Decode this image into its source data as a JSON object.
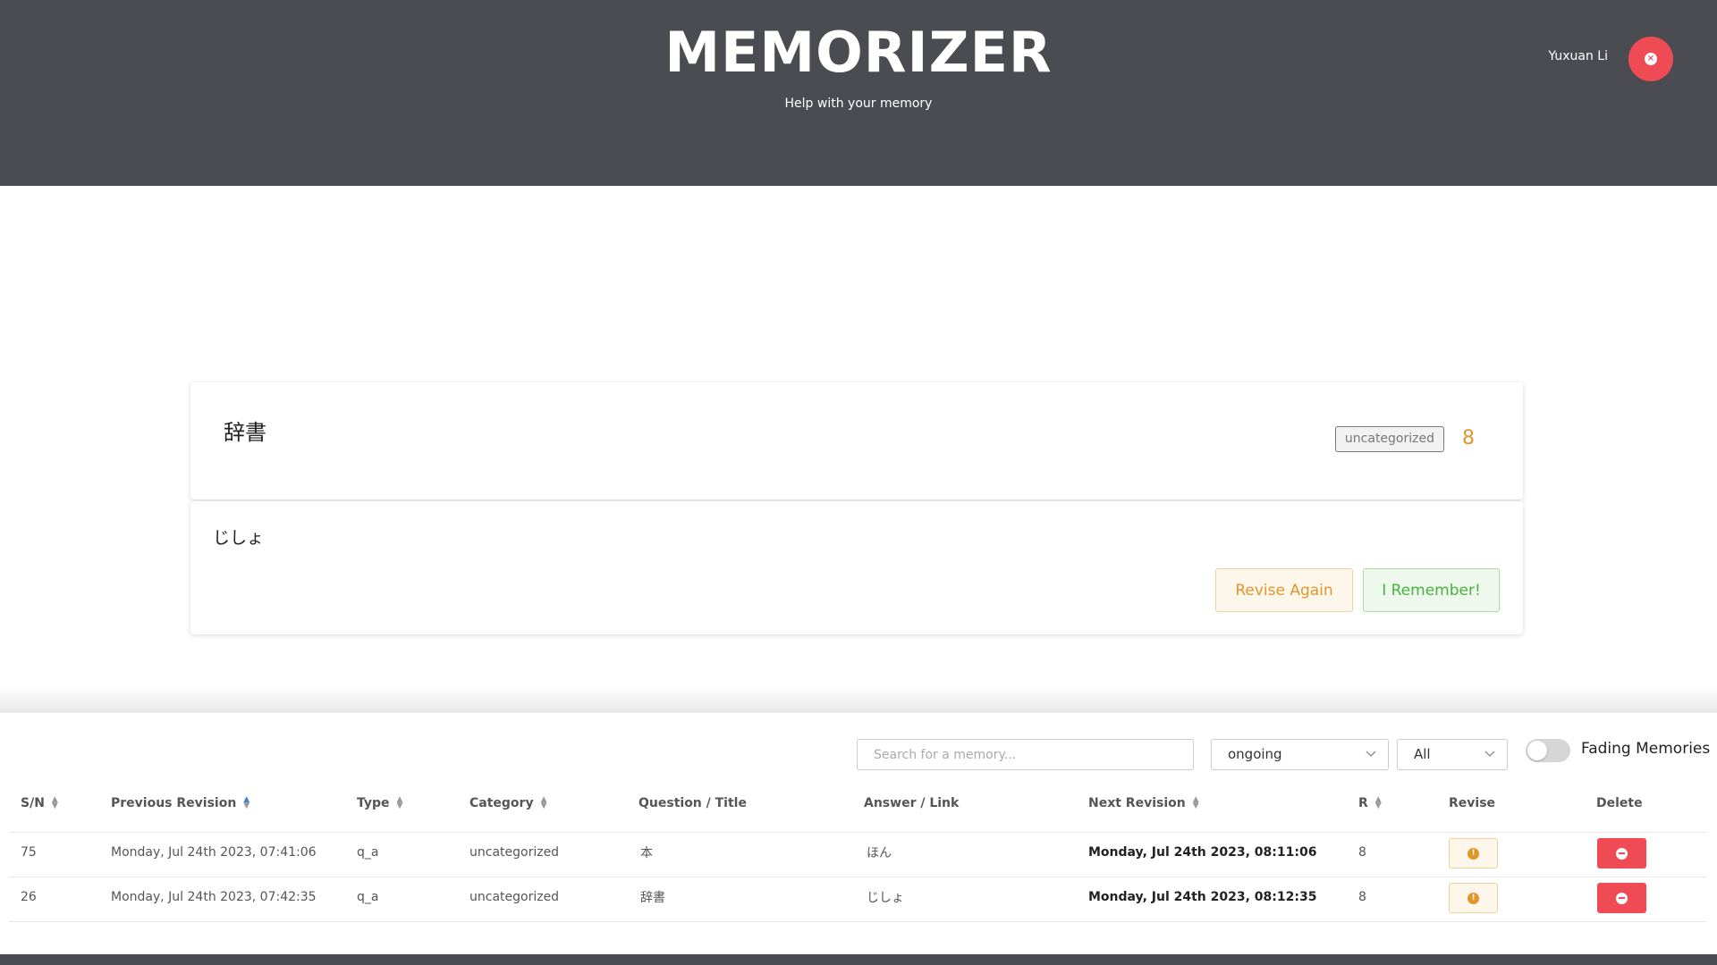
{
  "header": {
    "title": "MEMORIZER",
    "subtitle": "Help with your memory",
    "user_name": "Yuxuan Li",
    "logout_icon": "close-circle-icon"
  },
  "card": {
    "question": "辞書",
    "category": "uncategorized",
    "repetitions": "8",
    "answer": "じしょ",
    "revise_again_label": "Revise Again",
    "remember_label": "I Remember!"
  },
  "filters": {
    "search_placeholder": "Search for a memory...",
    "status_value": "ongoing",
    "category_value": "All",
    "fading_label": "Fading Memories",
    "fading_enabled": false
  },
  "table": {
    "headers": {
      "sn": "S/N",
      "previous_revision": "Previous Revision",
      "type": "Type",
      "category": "Category",
      "question": "Question / Title",
      "answer": "Answer / Link",
      "next_revision": "Next Revision",
      "r": "R",
      "revise": "Revise",
      "delete": "Delete"
    },
    "rows": [
      {
        "sn": "75",
        "previous_revision": "Monday, Jul 24th 2023, 07:41:06",
        "type": "q_a",
        "category": "uncategorized",
        "question": "本",
        "answer": "ほん",
        "next_revision": "Monday, Jul 24th 2023, 08:11:06",
        "r": "8"
      },
      {
        "sn": "26",
        "previous_revision": "Monday, Jul 24th 2023, 07:42:35",
        "type": "q_a",
        "category": "uncategorized",
        "question": "辞書",
        "answer": "じしょ",
        "next_revision": "Monday, Jul 24th 2023, 08:12:35",
        "r": "8"
      }
    ]
  },
  "colors": {
    "header_bg": "#4b4c51",
    "danger": "#ef4b55",
    "warning": "#e0962b",
    "success": "#46b33e",
    "sort_active": "#3b7fd9"
  }
}
